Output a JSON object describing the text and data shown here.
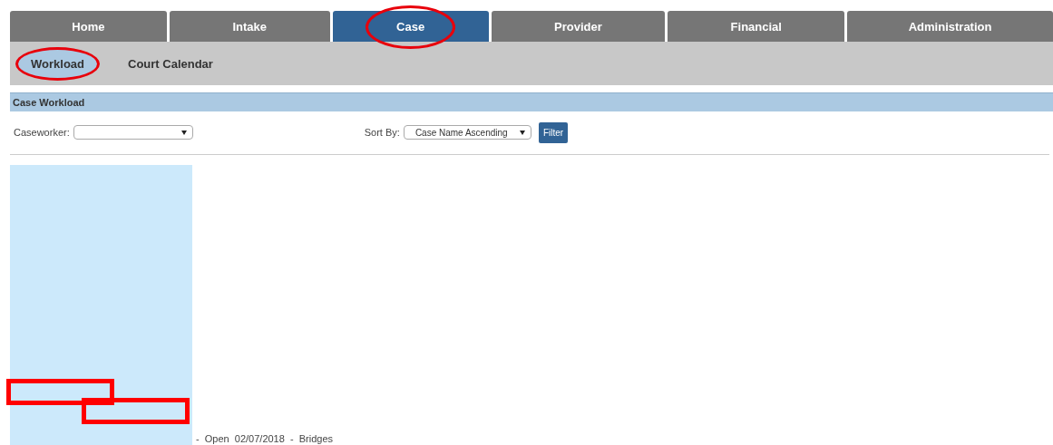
{
  "tabs": [
    {
      "label": "Home",
      "selected": false,
      "circled": false
    },
    {
      "label": "Intake",
      "selected": false,
      "circled": false
    },
    {
      "label": "Case",
      "selected": true,
      "circled": true
    },
    {
      "label": "Provider",
      "selected": false,
      "circled": false
    },
    {
      "label": "Financial",
      "selected": false,
      "circled": false
    },
    {
      "label": "Administration",
      "selected": false,
      "circled": false
    }
  ],
  "subtabs": [
    {
      "label": "Workload",
      "selected": true,
      "circled": true
    },
    {
      "label": "Court Calendar",
      "selected": false,
      "circled": false
    }
  ],
  "panel": {
    "title": "Case Workload",
    "caseworker": {
      "label": "Caseworker:"
    },
    "sort": {
      "label": "Sort By:",
      "value": "Case Name Ascending"
    },
    "filter_button": "Filter",
    "results": [
      {
        "text": "-  Open  02/07/2018  -  Bridges",
        "marked": true
      }
    ]
  }
}
